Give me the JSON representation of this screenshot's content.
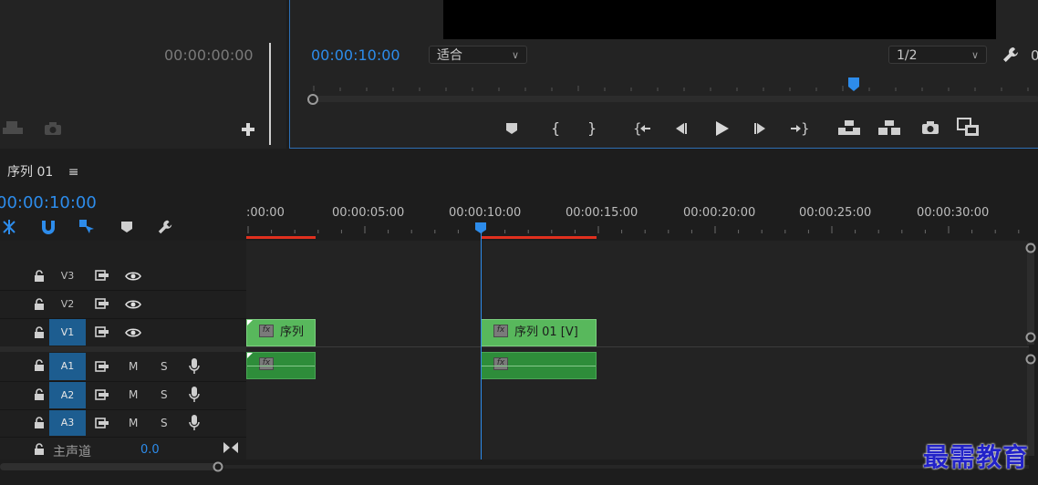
{
  "source_panel": {
    "timecode": "00:00:00:00"
  },
  "program_monitor": {
    "timecode": "00:00:10:00",
    "zoom_select": "适合",
    "resolution_select": "1/2",
    "cutoff_text": "0"
  },
  "sequence": {
    "tab_label": "序列 01",
    "menu_icon": "≡",
    "timecode": "00:00:10:00"
  },
  "ruler": {
    "labels": [
      ":00:00",
      "00:00:05:00",
      "00:00:10:00",
      "00:00:15:00",
      "00:00:20:00",
      "00:00:25:00",
      "00:00:30:00"
    ]
  },
  "tracks": {
    "v3": "V3",
    "v2": "V2",
    "v1": "V1",
    "a1": "A1",
    "a2": "A2",
    "a3": "A3",
    "mute": "M",
    "solo": "S",
    "master_label": "主声道",
    "master_value": "0.0"
  },
  "clips": {
    "v1_clip1_title": "序列",
    "v1_clip2_title": "序列 01 [V]",
    "fx": "fx"
  },
  "watermark": "最需教育",
  "colors": {
    "accent": "#2d8ceb",
    "video_clip": "#58b85c",
    "audio_clip": "#2e8d3a",
    "in_out_bar": "#e0301e"
  }
}
